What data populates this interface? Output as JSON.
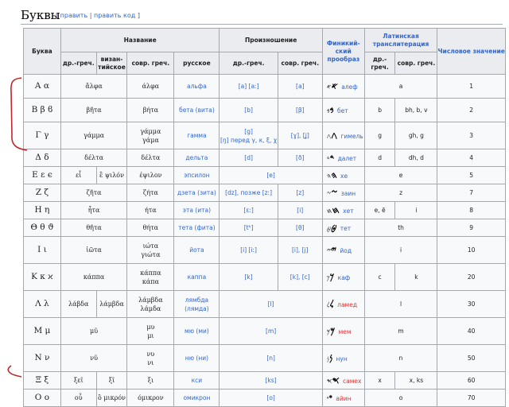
{
  "heading": {
    "title": "Буквы",
    "edit": "править",
    "sep": "|",
    "edit_code": "править код"
  },
  "headers": {
    "letter": "Буква",
    "name": "Название",
    "pron": "Произношение",
    "phoen": "Финикий-ский прообраз",
    "latin": "Латинская транслитерация",
    "numval": "Числовое значение",
    "sub": {
      "name_old": "др.-греч.",
      "name_byz": "визан-тийское",
      "name_mod": "совр. греч.",
      "name_ru": "русское",
      "pron_old": "др.-греч.",
      "pron_mod": "совр. греч.",
      "lat_old": "др.-греч.",
      "lat_mod": "совр. греч."
    }
  },
  "rows": [
    {
      "letter": "Α α",
      "old": "ἄλφα",
      "mod": "άλφα",
      "ru": "альфа",
      "p_old": "[a] [aː]",
      "p_mod": "[a]",
      "glyph": "𐤀",
      "small": "𐤀",
      "phn": "алеф",
      "lat": "a",
      "num": "1"
    },
    {
      "letter": "Β β ϐ",
      "old": "βῆτα",
      "mod": "βήτα",
      "ru": "бета (вита)",
      "p_old": "[b]",
      "p_mod": "[β]",
      "glyph": "𐤁",
      "small": "𐤁",
      "phn": "бет",
      "l_old": "b",
      "l_mod": "bh, b, v",
      "num": "2"
    },
    {
      "letter": "Γ γ",
      "old": "γάμμα",
      "mod": "γάμμα\nγάμα",
      "ru": "гамма",
      "p_old": "[g]\n[ŋ] перед γ, κ, ξ, χ",
      "p_mod": "[ɣ], [ʝ]",
      "glyph": "𐤂",
      "small": "𐤂",
      "phn": "гимель",
      "l_old": "g",
      "l_mod": "gh, g",
      "num": "3"
    },
    {
      "letter": "Δ δ",
      "old": "δέλτα",
      "mod": "δέλτα",
      "ru": "дельта",
      "p_old": "[d]",
      "p_mod": "[ð]",
      "glyph": "𐤃",
      "small": "𐤃",
      "phn": "далет",
      "l_old": "d",
      "l_mod": "dh, d",
      "num": "4"
    },
    {
      "letter": "Ε ε ϵ",
      "old": "εἶ",
      "byz": "ἒ ψιλόν",
      "mod": "έψιλον",
      "ru": "эпсилон",
      "p": "[e]",
      "glyph": "𐤄",
      "small": "𐤄",
      "phn": "хе",
      "lat": "e",
      "num": "5"
    },
    {
      "letter": "Ζ ζ",
      "old": "ζῆτα",
      "mod": "ζήτα",
      "ru": "дзета (зита)",
      "p_old": "[dz], позже [zː]",
      "p_mod": "[z]",
      "glyph": "𐤆",
      "small": "𐤆",
      "phn": "заин",
      "lat": "z",
      "num": "7"
    },
    {
      "letter": "Η η",
      "old": "ἦτα",
      "mod": "ήτα",
      "ru": "эта (ита)",
      "p_old": "[ɛː]",
      "p_mod": "[i]",
      "glyph": "𐤇",
      "small": "𐤇",
      "phn": "хет",
      "l_old": "e, ē",
      "l_mod": "i",
      "num": "8"
    },
    {
      "letter": "Θ θ ϑ",
      "old": "θῆτα",
      "mod": "θήτα",
      "ru": "тета (фита)",
      "p_old": "[tʰ]",
      "p_mod": "[θ]",
      "glyph": "𐤈",
      "small": "𐤈",
      "phn": "тет",
      "lat": "th",
      "num": "9"
    },
    {
      "letter": "Ι ι",
      "old": "ἰῶτα",
      "mod": "ιώτα\nγιώτα",
      "ru": "йота",
      "p_old": "[i] [iː]",
      "p_mod": "[i], [j]",
      "glyph": "𐤉",
      "small": "𐤉",
      "phn": "йод",
      "lat": "i",
      "num": "10"
    },
    {
      "letter": "Κ κ ϰ",
      "old": "κάππα",
      "mod": "κάππα\nκάπα",
      "ru": "каппа",
      "p_old": "[k]",
      "p_mod": "[k], [c]",
      "glyph": "𐤊",
      "small": "𐤊",
      "phn": "каф",
      "l_old": "c",
      "l_mod": "k",
      "num": "20"
    },
    {
      "letter": "Λ λ",
      "old": "λάβδα",
      "byz": "λάμβδα",
      "mod": "λάμβδα\nλάμδα",
      "ru": "лямбда (лямда)",
      "p": "[l]",
      "glyph": "𐤋",
      "small": "𐤋",
      "phn": "ламед",
      "red": true,
      "lat": "l",
      "num": "30"
    },
    {
      "letter": "Μ μ",
      "old": "μῦ",
      "mod": "μυ\nμι",
      "ru": "мю (ми)",
      "p": "[m]",
      "glyph": "𐤌",
      "small": "𐤌",
      "phn": "мем",
      "red": true,
      "lat": "m",
      "num": "40"
    },
    {
      "letter": "Ν ν",
      "old": "νῦ",
      "mod": "νυ\nνι",
      "ru": "ню (ни)",
      "p": "[n]",
      "glyph": "𐤍",
      "small": "𐤍",
      "phn": "нун",
      "lat": "n",
      "num": "50"
    },
    {
      "letter": "Ξ ξ",
      "old": "ξεῖ",
      "byz": "ξῖ",
      "mod": "ξι",
      "ru": "кси",
      "p": "[ks]",
      "glyph": "𐤎",
      "small": "𐤎",
      "phn": "самех",
      "red": true,
      "l_old": "x",
      "l_mod": "x, ks",
      "num": "60"
    },
    {
      "letter": "Ο ο",
      "old": "οὖ",
      "byz": "ὂ μικρόν",
      "mod": "όμικρον",
      "ru": "омикрон",
      "p": "[o]",
      "glyph": "𐤏",
      "small": "𐤏",
      "phn": "айин",
      "red": true,
      "lat": "o",
      "num": "70"
    }
  ]
}
